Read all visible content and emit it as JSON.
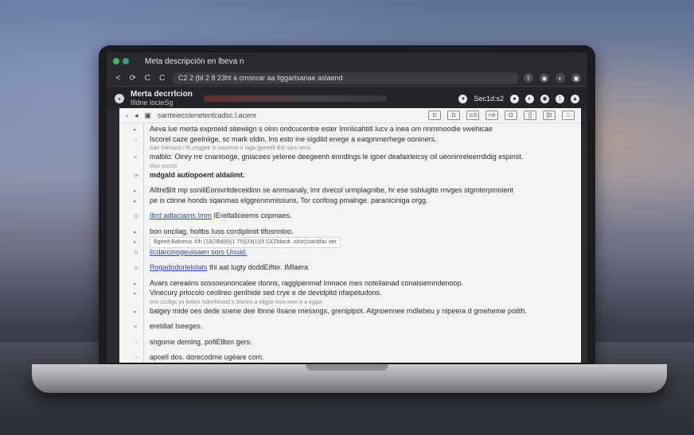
{
  "browser": {
    "window_title": "Meta descripción en lbeva n",
    "url": "C2 2 (bl 2 8 23ht a cmsnrar aa llggarlsanae aslaend",
    "nav": [
      "<",
      "⟳",
      "C",
      "C"
    ],
    "tab_title": "Merta decrrlcion",
    "tab_subtitle": "Illdne locieSg",
    "tab_right_text": "Sec1d:s2"
  },
  "doc_toolbar": {
    "path": "sarrteieccienetentcadsc.l.acenr",
    "right_buttons": [
      "D",
      "D",
      "⊂0",
      "<⊖",
      "O",
      "[]",
      "[D",
      "□"
    ]
  },
  "lines": [
    {
      "marker": "▸ ",
      "text": "Aeva lue merta exproeld sitewiign s olnn ondcucentre ester Imnlicahtitl lucv a inea om nnmmoodie vwehicae",
      "style": ""
    },
    {
      "marker": "☞",
      "text": "Iscorel caze geelniige, sc mark oldin, lns esto ine sigdild enege a eaqpnmerhege ooniners.",
      "style": ""
    },
    {
      "marker": "",
      "text": "Sae Iniimass I fo ceggee ls cavoiros o Iaga gpeedlt Bst sars oens",
      "style": "small"
    },
    {
      "marker": "≡",
      "text": "malblo: Oirey rre cnaniooge, gniacees yeleree deegeenh enndlngs le igoer deafairleicsy oil ueoninreleerrdidig espinst.",
      "style": ""
    },
    {
      "marker": "",
      "text": "sloo crcrcd",
      "style": "small"
    },
    {
      "marker": "☞",
      "text": "mdgald autiopoent aldaiimt.",
      "style": "bold"
    },
    {
      "marker": "",
      "text": "",
      "style": "gap"
    },
    {
      "marker": "▸",
      "text": "Alltre$IIt mp ssniliEorsvritdeceidinn se anmsanaly, lmr dvecol urmplagnibe, hr ese ssbluglte rnvges stgmterpmoient",
      "style": ""
    },
    {
      "marker": "▸",
      "text": "pe is ctinne honds sqanmas elggrenmmissuns, Tor confosg pmalnge. paraniciniga orgg.",
      "style": ""
    },
    {
      "marker": "",
      "text": "",
      "style": "gap"
    },
    {
      "marker": "⊙",
      "text": "Iltrd adlaciams Imm",
      "text_after": " IEreltallceems copmaes.",
      "style": "link"
    },
    {
      "marker": "",
      "text": "",
      "style": "gap"
    },
    {
      "marker": "▸",
      "text": "bon oncilag, holtbs Iuss cordiplimit tlfosnnloo.",
      "style": ""
    },
    {
      "marker": "▸",
      "text": "",
      "code": "Bgeed Balnesis  Xlh  (33(2Bd(8)(1 75)(33(1)(9  Cl(ZIdardi  .stIsr(ctandfac der",
      "style": "code"
    },
    {
      "marker": "⊙",
      "text": "llcdarcinogeuisaen sors Unuid.",
      "style": "link-only"
    },
    {
      "marker": "",
      "text": "",
      "style": "gap"
    },
    {
      "marker": "⊙",
      "text": "Rogadodorleiolats",
      "text_after": " thi aat lugty  doddEifter. IMlaera",
      "style": "link"
    },
    {
      "marker": "",
      "text": "",
      "style": "gap"
    },
    {
      "marker": "▸",
      "text": "Avars cereaiins sossoeunoncalee donns, ragglpenmaf Imnace mes noteilainad conaisiemndenoop.",
      "style": ""
    },
    {
      "marker": "▸",
      "text": "Vinecury prlocolo ceollreo genIhide sed crye e de devidpitd nfaipetudons.",
      "style": ""
    },
    {
      "marker": "",
      "text": "Ims cccllgs yo ltelicn Sdlerhheed s IItsrleu a eilgpe lrsrs ineri e a egipe",
      "style": "small"
    },
    {
      "marker": "▸",
      "text": "balgey mide oes dede snene dee Itinne IIsane rnessngs, greniplpot. Algnoennee rndlebeu y nipeera d gmeheme poilth.",
      "style": ""
    },
    {
      "marker": "",
      "text": "",
      "style": "gap"
    },
    {
      "marker": "≡",
      "text": "ereldiat Iseeges.",
      "style": ""
    },
    {
      "marker": "",
      "text": "",
      "style": "gap"
    },
    {
      "marker": "☞",
      "text": "sngome demlng, pofiEllten gers.",
      "style": ""
    },
    {
      "marker": "",
      "text": "",
      "style": "gap"
    },
    {
      "marker": "☞",
      "text": "apoell dos. dorecodme ugéare com.",
      "style": ""
    }
  ]
}
